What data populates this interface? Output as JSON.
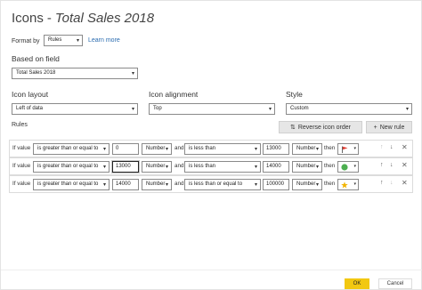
{
  "dialog": {
    "title": "Icons",
    "separator": "-",
    "field_title": "Total Sales 2018"
  },
  "format_by": {
    "label": "Format by",
    "value": "Rules",
    "learn_more": "Learn more"
  },
  "based_on": {
    "label": "Based on field",
    "value": "Total Sales 2018"
  },
  "icon_layout": {
    "label": "Icon layout",
    "value": "Left of data"
  },
  "icon_alignment": {
    "label": "Icon alignment",
    "value": "Top"
  },
  "style": {
    "label": "Style",
    "value": "Custom"
  },
  "rules": {
    "label": "Rules",
    "reverse_label": "Reverse icon order",
    "new_rule_label": "New rule",
    "items": [
      {
        "if_label": "If value",
        "op1": "is greater than or equal to",
        "val1": "0",
        "type1": "Number",
        "and_label": "and",
        "op2": "is less than",
        "val2": "13000",
        "type2": "Number",
        "then_label": "then",
        "icon": "red-flag-icon",
        "icon_color": "#e03c31"
      },
      {
        "if_label": "If value",
        "op1": "is greater than or equal to",
        "val1": "13000",
        "type1": "Number",
        "and_label": "and",
        "op2": "is less than",
        "val2": "14000",
        "type2": "Number",
        "then_label": "then",
        "icon": "green-circle-icon",
        "icon_color": "#4caf50"
      },
      {
        "if_label": "If value",
        "op1": "is greater than or equal to",
        "val1": "14000",
        "type1": "Number",
        "and_label": "and",
        "op2": "is less than or equal to",
        "val2": "100000",
        "type2": "Number",
        "then_label": "then",
        "icon": "gold-star-icon",
        "icon_color": "#f2b400"
      }
    ]
  },
  "footer": {
    "ok_label": "OK",
    "cancel_label": "Cancel",
    "ok_color": "#f2c811"
  }
}
